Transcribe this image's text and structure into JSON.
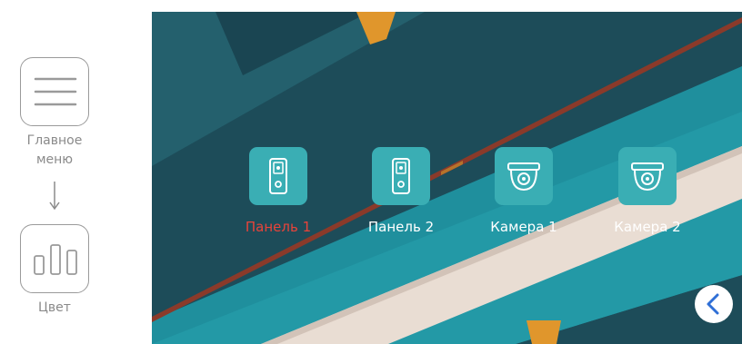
{
  "guide": {
    "main_menu_label_line1": "Главное",
    "main_menu_label_line2": "меню",
    "color_label": "Цвет"
  },
  "devices": [
    {
      "label": "Панель 1",
      "icon": "door-panel-icon",
      "active": true
    },
    {
      "label": "Панель 2",
      "icon": "door-panel-icon",
      "active": false
    },
    {
      "label": "Камера 1",
      "icon": "dome-camera-icon",
      "active": false
    },
    {
      "label": "Камера 2",
      "icon": "dome-camera-icon",
      "active": false
    }
  ],
  "colors": {
    "accent_teal": "#3aaeb4",
    "active_label": "#e8433a",
    "back_button": "#2f6fd6"
  }
}
